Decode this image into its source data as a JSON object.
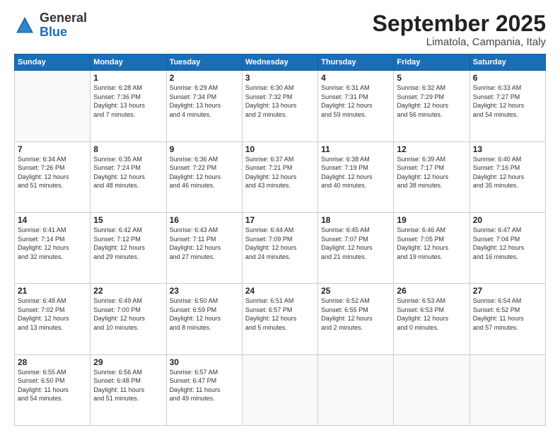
{
  "logo": {
    "general": "General",
    "blue": "Blue"
  },
  "header": {
    "month": "September 2025",
    "location": "Limatola, Campania, Italy"
  },
  "weekdays": [
    "Sunday",
    "Monday",
    "Tuesday",
    "Wednesday",
    "Thursday",
    "Friday",
    "Saturday"
  ],
  "weeks": [
    [
      {
        "day": "",
        "info": ""
      },
      {
        "day": "1",
        "info": "Sunrise: 6:28 AM\nSunset: 7:36 PM\nDaylight: 13 hours\nand 7 minutes."
      },
      {
        "day": "2",
        "info": "Sunrise: 6:29 AM\nSunset: 7:34 PM\nDaylight: 13 hours\nand 4 minutes."
      },
      {
        "day": "3",
        "info": "Sunrise: 6:30 AM\nSunset: 7:32 PM\nDaylight: 13 hours\nand 2 minutes."
      },
      {
        "day": "4",
        "info": "Sunrise: 6:31 AM\nSunset: 7:31 PM\nDaylight: 12 hours\nand 59 minutes."
      },
      {
        "day": "5",
        "info": "Sunrise: 6:32 AM\nSunset: 7:29 PM\nDaylight: 12 hours\nand 56 minutes."
      },
      {
        "day": "6",
        "info": "Sunrise: 6:33 AM\nSunset: 7:27 PM\nDaylight: 12 hours\nand 54 minutes."
      }
    ],
    [
      {
        "day": "7",
        "info": "Sunrise: 6:34 AM\nSunset: 7:26 PM\nDaylight: 12 hours\nand 51 minutes."
      },
      {
        "day": "8",
        "info": "Sunrise: 6:35 AM\nSunset: 7:24 PM\nDaylight: 12 hours\nand 48 minutes."
      },
      {
        "day": "9",
        "info": "Sunrise: 6:36 AM\nSunset: 7:22 PM\nDaylight: 12 hours\nand 46 minutes."
      },
      {
        "day": "10",
        "info": "Sunrise: 6:37 AM\nSunset: 7:21 PM\nDaylight: 12 hours\nand 43 minutes."
      },
      {
        "day": "11",
        "info": "Sunrise: 6:38 AM\nSunset: 7:19 PM\nDaylight: 12 hours\nand 40 minutes."
      },
      {
        "day": "12",
        "info": "Sunrise: 6:39 AM\nSunset: 7:17 PM\nDaylight: 12 hours\nand 38 minutes."
      },
      {
        "day": "13",
        "info": "Sunrise: 6:40 AM\nSunset: 7:16 PM\nDaylight: 12 hours\nand 35 minutes."
      }
    ],
    [
      {
        "day": "14",
        "info": "Sunrise: 6:41 AM\nSunset: 7:14 PM\nDaylight: 12 hours\nand 32 minutes."
      },
      {
        "day": "15",
        "info": "Sunrise: 6:42 AM\nSunset: 7:12 PM\nDaylight: 12 hours\nand 29 minutes."
      },
      {
        "day": "16",
        "info": "Sunrise: 6:43 AM\nSunset: 7:11 PM\nDaylight: 12 hours\nand 27 minutes."
      },
      {
        "day": "17",
        "info": "Sunrise: 6:44 AM\nSunset: 7:09 PM\nDaylight: 12 hours\nand 24 minutes."
      },
      {
        "day": "18",
        "info": "Sunrise: 6:45 AM\nSunset: 7:07 PM\nDaylight: 12 hours\nand 21 minutes."
      },
      {
        "day": "19",
        "info": "Sunrise: 6:46 AM\nSunset: 7:05 PM\nDaylight: 12 hours\nand 19 minutes."
      },
      {
        "day": "20",
        "info": "Sunrise: 6:47 AM\nSunset: 7:04 PM\nDaylight: 12 hours\nand 16 minutes."
      }
    ],
    [
      {
        "day": "21",
        "info": "Sunrise: 6:48 AM\nSunset: 7:02 PM\nDaylight: 12 hours\nand 13 minutes."
      },
      {
        "day": "22",
        "info": "Sunrise: 6:49 AM\nSunset: 7:00 PM\nDaylight: 12 hours\nand 10 minutes."
      },
      {
        "day": "23",
        "info": "Sunrise: 6:50 AM\nSunset: 6:59 PM\nDaylight: 12 hours\nand 8 minutes."
      },
      {
        "day": "24",
        "info": "Sunrise: 6:51 AM\nSunset: 6:57 PM\nDaylight: 12 hours\nand 5 minutes."
      },
      {
        "day": "25",
        "info": "Sunrise: 6:52 AM\nSunset: 6:55 PM\nDaylight: 12 hours\nand 2 minutes."
      },
      {
        "day": "26",
        "info": "Sunrise: 6:53 AM\nSunset: 6:53 PM\nDaylight: 12 hours\nand 0 minutes."
      },
      {
        "day": "27",
        "info": "Sunrise: 6:54 AM\nSunset: 6:52 PM\nDaylight: 11 hours\nand 57 minutes."
      }
    ],
    [
      {
        "day": "28",
        "info": "Sunrise: 6:55 AM\nSunset: 6:50 PM\nDaylight: 11 hours\nand 54 minutes."
      },
      {
        "day": "29",
        "info": "Sunrise: 6:56 AM\nSunset: 6:48 PM\nDaylight: 11 hours\nand 51 minutes."
      },
      {
        "day": "30",
        "info": "Sunrise: 6:57 AM\nSunset: 6:47 PM\nDaylight: 11 hours\nand 49 minutes."
      },
      {
        "day": "",
        "info": ""
      },
      {
        "day": "",
        "info": ""
      },
      {
        "day": "",
        "info": ""
      },
      {
        "day": "",
        "info": ""
      }
    ]
  ]
}
